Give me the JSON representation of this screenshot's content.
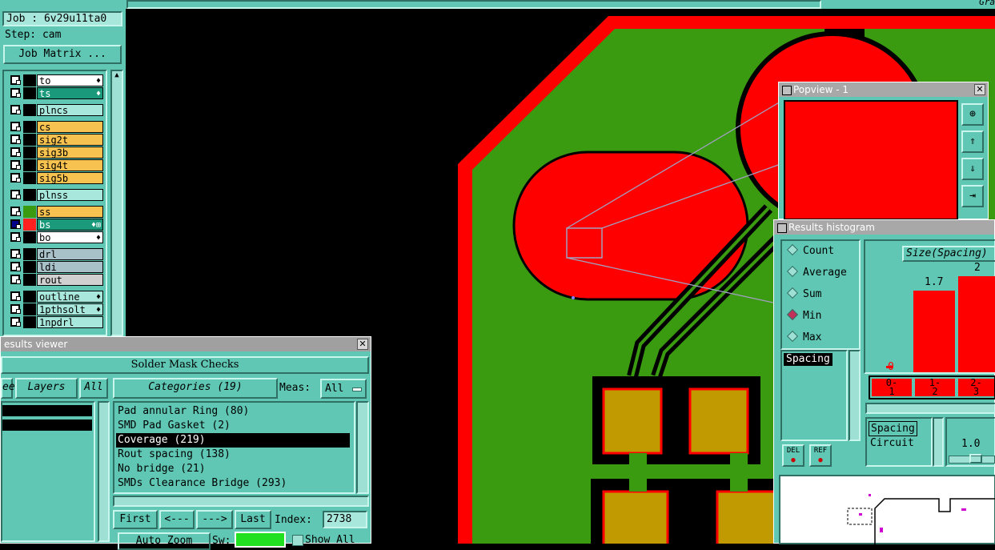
{
  "job": {
    "label": "Job : 6v29u11ta0",
    "step": "Step: cam",
    "matrix_btn": "Job Matrix ..."
  },
  "top_right_text": "Gra",
  "layers": [
    {
      "name": "to",
      "color": "#ffffff",
      "flag": "♦"
    },
    {
      "name": "ts",
      "color": "#1a9a7a",
      "flag": "♦"
    },
    {
      "name": "plncs",
      "color": "#a8e8dc",
      "flag": ""
    },
    {
      "name": "cs",
      "color": "#f7c24f",
      "flag": ""
    },
    {
      "name": "sig2t",
      "color": "#f7c24f",
      "flag": ""
    },
    {
      "name": "sig3b",
      "color": "#f7c24f",
      "flag": ""
    },
    {
      "name": "sig4t",
      "color": "#f7c24f",
      "flag": ""
    },
    {
      "name": "sig5b",
      "color": "#f7c24f",
      "flag": ""
    },
    {
      "name": "plnss",
      "color": "#a8e8dc",
      "flag": ""
    },
    {
      "name": "ss",
      "color": "#f7c24f",
      "flag": ""
    },
    {
      "name": "bs",
      "color": "#1a9a7a",
      "flag": "♦⊞"
    },
    {
      "name": "bo",
      "color": "#ffffff",
      "flag": "♦"
    },
    {
      "name": "drl",
      "color": "#a8c0c8",
      "flag": ""
    },
    {
      "name": "ldi",
      "color": "#a8c0c8",
      "flag": ""
    },
    {
      "name": "rout",
      "color": "#d0d0d0",
      "flag": ""
    },
    {
      "name": "outline",
      "color": "#a8e8dc",
      "flag": "♦"
    },
    {
      "name": "1pthsolt",
      "color": "#a8e8dc",
      "flag": "♦"
    },
    {
      "name": "1npdrl",
      "color": "#a8e8dc",
      "flag": ""
    }
  ],
  "results_viewer": {
    "title": "esults viewer",
    "header": "Solder Mask Checks",
    "left_btn_partial": "ee",
    "layers_btn": "Layers",
    "all_btn": "All",
    "categories_btn": "Categories (19)",
    "meas_label": "Meas:",
    "meas_value": "All",
    "items": [
      "Pad annular Ring (80)",
      "SMD Pad Gasket (2)",
      "Coverage (219)",
      "Rout spacing (138)",
      "No bridge (21)",
      "SMDs Clearance Bridge (293)"
    ],
    "first_btn": "First",
    "prev_btn": "<---",
    "next_btn": "--->",
    "last_btn": "Last",
    "index_label": "Index:",
    "index_value": "2738",
    "autozoom_btn": "Auto Zoom",
    "sw_label": "Sw:",
    "showall_label": "Show All"
  },
  "popview": {
    "title": "Popview - 1"
  },
  "histogram": {
    "title": "Results histogram",
    "modes": [
      "Count",
      "Average",
      "Sum",
      "Min",
      "Max"
    ],
    "selected_mode": "Min",
    "attr_list": [
      "Spacing"
    ],
    "size_label": "Size(Spacing)",
    "bar_labels": [
      "0",
      "1.7",
      "2"
    ],
    "bins": [
      "0-\n1",
      "1-\n2",
      "2-\n3"
    ],
    "del_btn": "DEL",
    "ref_btn": "REF",
    "filter_items": [
      "Spacing",
      "Circuit"
    ],
    "slider_value": "1.0"
  },
  "colors": {
    "teal": "#5fc7b3",
    "pcb_green": "#3a9a10",
    "copper_red": "#ff0000",
    "pad_gold": "#c09a00"
  }
}
